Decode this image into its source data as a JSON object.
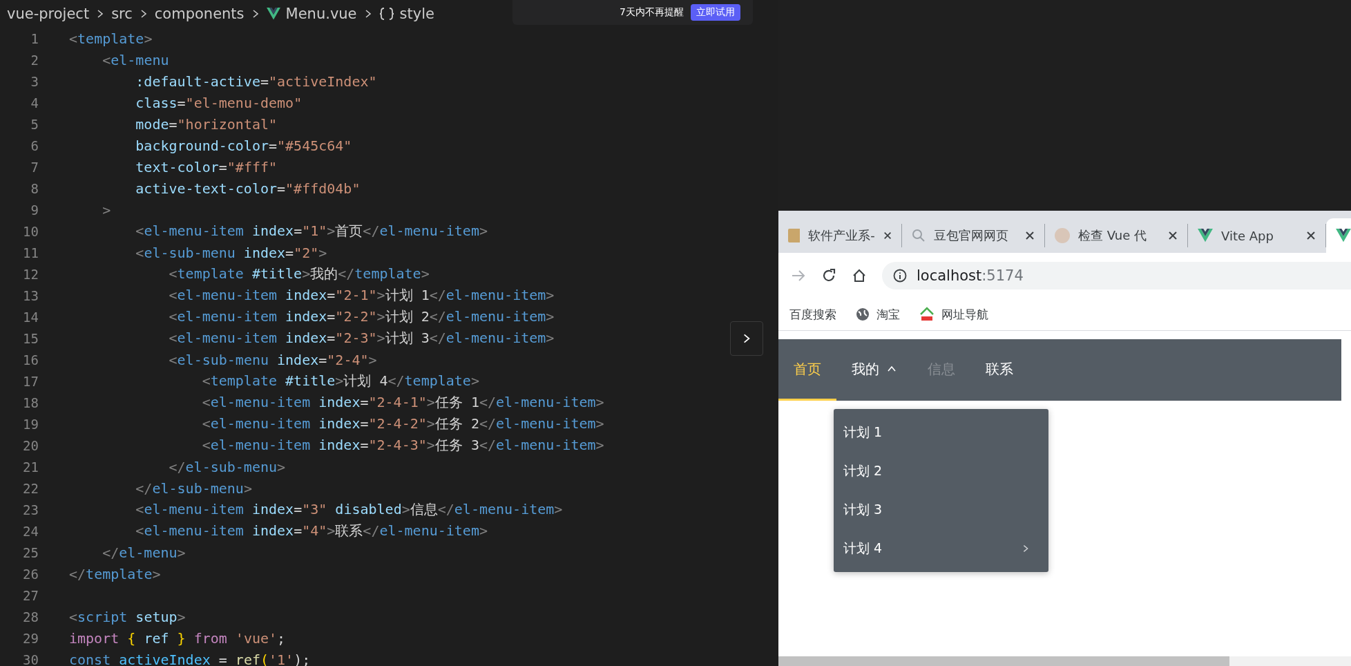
{
  "breadcrumb": [
    {
      "text": "vue-project"
    },
    {
      "text": "src"
    },
    {
      "text": "components"
    },
    {
      "text": "Menu.vue"
    },
    {
      "text": "style"
    }
  ],
  "notification": {
    "text": "7天内不再提醒",
    "button": "立即试用"
  },
  "code_lines": [
    {
      "number": "1",
      "tokens": [
        {
          "kind": "punct",
          "text": "<"
        },
        {
          "kind": "tag",
          "text": "template"
        },
        {
          "kind": "punct",
          "text": ">"
        }
      ]
    },
    {
      "number": "2",
      "tokens": [
        {
          "kind": "punct",
          "text": "    <"
        },
        {
          "kind": "tag",
          "text": "el-menu"
        }
      ]
    },
    {
      "number": "3",
      "tokens": [
        {
          "kind": "attr",
          "text": "        :default-active"
        },
        {
          "kind": "text",
          "text": "="
        },
        {
          "kind": "string",
          "text": "\"activeIndex\""
        }
      ]
    },
    {
      "number": "4",
      "tokens": [
        {
          "kind": "attr",
          "text": "        class"
        },
        {
          "kind": "text",
          "text": "="
        },
        {
          "kind": "string",
          "text": "\"el-menu-demo\""
        }
      ]
    },
    {
      "number": "5",
      "tokens": [
        {
          "kind": "attr",
          "text": "        mode"
        },
        {
          "kind": "text",
          "text": "="
        },
        {
          "kind": "string",
          "text": "\"horizontal\""
        }
      ]
    },
    {
      "number": "6",
      "tokens": [
        {
          "kind": "attr",
          "text": "        background-color"
        },
        {
          "kind": "text",
          "text": "="
        },
        {
          "kind": "string",
          "text": "\"#545c64\""
        }
      ]
    },
    {
      "number": "7",
      "tokens": [
        {
          "kind": "attr",
          "text": "        text-color"
        },
        {
          "kind": "text",
          "text": "="
        },
        {
          "kind": "string",
          "text": "\"#fff\""
        }
      ]
    },
    {
      "number": "8",
      "tokens": [
        {
          "kind": "attr",
          "text": "        active-text-color"
        },
        {
          "kind": "text",
          "text": "="
        },
        {
          "kind": "string",
          "text": "\"#ffd04b\""
        }
      ]
    },
    {
      "number": "9",
      "tokens": [
        {
          "kind": "punct",
          "text": "    >"
        }
      ]
    },
    {
      "number": "10",
      "tokens": [
        {
          "kind": "punct",
          "text": "        <"
        },
        {
          "kind": "tag",
          "text": "el-menu-item"
        },
        {
          "kind": "attr",
          "text": " index"
        },
        {
          "kind": "text",
          "text": "="
        },
        {
          "kind": "string",
          "text": "\"1\""
        },
        {
          "kind": "punct",
          "text": ">"
        },
        {
          "kind": "text",
          "text": "首页"
        },
        {
          "kind": "punct",
          "text": "</"
        },
        {
          "kind": "tag",
          "text": "el-menu-item"
        },
        {
          "kind": "punct",
          "text": ">"
        }
      ]
    },
    {
      "number": "11",
      "tokens": [
        {
          "kind": "punct",
          "text": "        <"
        },
        {
          "kind": "tag",
          "text": "el-sub-menu"
        },
        {
          "kind": "attr",
          "text": " index"
        },
        {
          "kind": "text",
          "text": "="
        },
        {
          "kind": "string",
          "text": "\"2\""
        },
        {
          "kind": "punct",
          "text": ">"
        }
      ]
    },
    {
      "number": "12",
      "tokens": [
        {
          "kind": "punct",
          "text": "            <"
        },
        {
          "kind": "tag",
          "text": "template"
        },
        {
          "kind": "attr",
          "text": " #title"
        },
        {
          "kind": "punct",
          "text": ">"
        },
        {
          "kind": "text",
          "text": "我的"
        },
        {
          "kind": "punct",
          "text": "</"
        },
        {
          "kind": "tag",
          "text": "template"
        },
        {
          "kind": "punct",
          "text": ">"
        }
      ]
    },
    {
      "number": "13",
      "tokens": [
        {
          "kind": "punct",
          "text": "            <"
        },
        {
          "kind": "tag",
          "text": "el-menu-item"
        },
        {
          "kind": "attr",
          "text": " index"
        },
        {
          "kind": "text",
          "text": "="
        },
        {
          "kind": "string",
          "text": "\"2-1\""
        },
        {
          "kind": "punct",
          "text": ">"
        },
        {
          "kind": "text",
          "text": "计划 1"
        },
        {
          "kind": "punct",
          "text": "</"
        },
        {
          "kind": "tag",
          "text": "el-menu-item"
        },
        {
          "kind": "punct",
          "text": ">"
        }
      ]
    },
    {
      "number": "14",
      "tokens": [
        {
          "kind": "punct",
          "text": "            <"
        },
        {
          "kind": "tag",
          "text": "el-menu-item"
        },
        {
          "kind": "attr",
          "text": " index"
        },
        {
          "kind": "text",
          "text": "="
        },
        {
          "kind": "string",
          "text": "\"2-2\""
        },
        {
          "kind": "punct",
          "text": ">"
        },
        {
          "kind": "text",
          "text": "计划 2"
        },
        {
          "kind": "punct",
          "text": "</"
        },
        {
          "kind": "tag",
          "text": "el-menu-item"
        },
        {
          "kind": "punct",
          "text": ">"
        }
      ]
    },
    {
      "number": "15",
      "tokens": [
        {
          "kind": "punct",
          "text": "            <"
        },
        {
          "kind": "tag",
          "text": "el-menu-item"
        },
        {
          "kind": "attr",
          "text": " index"
        },
        {
          "kind": "text",
          "text": "="
        },
        {
          "kind": "string",
          "text": "\"2-3\""
        },
        {
          "kind": "punct",
          "text": ">"
        },
        {
          "kind": "text",
          "text": "计划 3"
        },
        {
          "kind": "punct",
          "text": "</"
        },
        {
          "kind": "tag",
          "text": "el-menu-item"
        },
        {
          "kind": "punct",
          "text": ">"
        }
      ]
    },
    {
      "number": "16",
      "tokens": [
        {
          "kind": "punct",
          "text": "            <"
        },
        {
          "kind": "tag",
          "text": "el-sub-menu"
        },
        {
          "kind": "attr",
          "text": " index"
        },
        {
          "kind": "text",
          "text": "="
        },
        {
          "kind": "string",
          "text": "\"2-4\""
        },
        {
          "kind": "punct",
          "text": ">"
        }
      ]
    },
    {
      "number": "17",
      "tokens": [
        {
          "kind": "punct",
          "text": "                <"
        },
        {
          "kind": "tag",
          "text": "template"
        },
        {
          "kind": "attr",
          "text": " #title"
        },
        {
          "kind": "punct",
          "text": ">"
        },
        {
          "kind": "text",
          "text": "计划 4"
        },
        {
          "kind": "punct",
          "text": "</"
        },
        {
          "kind": "tag",
          "text": "template"
        },
        {
          "kind": "punct",
          "text": ">"
        }
      ]
    },
    {
      "number": "18",
      "tokens": [
        {
          "kind": "punct",
          "text": "                <"
        },
        {
          "kind": "tag",
          "text": "el-menu-item"
        },
        {
          "kind": "attr",
          "text": " index"
        },
        {
          "kind": "text",
          "text": "="
        },
        {
          "kind": "string",
          "text": "\"2-4-1\""
        },
        {
          "kind": "punct",
          "text": ">"
        },
        {
          "kind": "text",
          "text": "任务 1"
        },
        {
          "kind": "punct",
          "text": "</"
        },
        {
          "kind": "tag",
          "text": "el-menu-item"
        },
        {
          "kind": "punct",
          "text": ">"
        }
      ]
    },
    {
      "number": "19",
      "tokens": [
        {
          "kind": "punct",
          "text": "                <"
        },
        {
          "kind": "tag",
          "text": "el-menu-item"
        },
        {
          "kind": "attr",
          "text": " index"
        },
        {
          "kind": "text",
          "text": "="
        },
        {
          "kind": "string",
          "text": "\"2-4-2\""
        },
        {
          "kind": "punct",
          "text": ">"
        },
        {
          "kind": "text",
          "text": "任务 2"
        },
        {
          "kind": "punct",
          "text": "</"
        },
        {
          "kind": "tag",
          "text": "el-menu-item"
        },
        {
          "kind": "punct",
          "text": ">"
        }
      ]
    },
    {
      "number": "20",
      "tokens": [
        {
          "kind": "punct",
          "text": "                <"
        },
        {
          "kind": "tag",
          "text": "el-menu-item"
        },
        {
          "kind": "attr",
          "text": " index"
        },
        {
          "kind": "text",
          "text": "="
        },
        {
          "kind": "string",
          "text": "\"2-4-3\""
        },
        {
          "kind": "punct",
          "text": ">"
        },
        {
          "kind": "text",
          "text": "任务 3"
        },
        {
          "kind": "punct",
          "text": "</"
        },
        {
          "kind": "tag",
          "text": "el-menu-item"
        },
        {
          "kind": "punct",
          "text": ">"
        }
      ]
    },
    {
      "number": "21",
      "tokens": [
        {
          "kind": "punct",
          "text": "            </"
        },
        {
          "kind": "tag",
          "text": "el-sub-menu"
        },
        {
          "kind": "punct",
          "text": ">"
        }
      ]
    },
    {
      "number": "22",
      "tokens": [
        {
          "kind": "punct",
          "text": "        </"
        },
        {
          "kind": "tag",
          "text": "el-sub-menu"
        },
        {
          "kind": "punct",
          "text": ">"
        }
      ]
    },
    {
      "number": "23",
      "tokens": [
        {
          "kind": "punct",
          "text": "        <"
        },
        {
          "kind": "tag",
          "text": "el-menu-item"
        },
        {
          "kind": "attr",
          "text": " index"
        },
        {
          "kind": "text",
          "text": "="
        },
        {
          "kind": "string",
          "text": "\"3\""
        },
        {
          "kind": "attr",
          "text": " disabled"
        },
        {
          "kind": "punct",
          "text": ">"
        },
        {
          "kind": "text",
          "text": "信息"
        },
        {
          "kind": "punct",
          "text": "</"
        },
        {
          "kind": "tag",
          "text": "el-menu-item"
        },
        {
          "kind": "punct",
          "text": ">"
        }
      ]
    },
    {
      "number": "24",
      "tokens": [
        {
          "kind": "punct",
          "text": "        <"
        },
        {
          "kind": "tag",
          "text": "el-menu-item"
        },
        {
          "kind": "attr",
          "text": " index"
        },
        {
          "kind": "text",
          "text": "="
        },
        {
          "kind": "string",
          "text": "\"4\""
        },
        {
          "kind": "punct",
          "text": ">"
        },
        {
          "kind": "text",
          "text": "联系"
        },
        {
          "kind": "punct",
          "text": "</"
        },
        {
          "kind": "tag",
          "text": "el-menu-item"
        },
        {
          "kind": "punct",
          "text": ">"
        }
      ]
    },
    {
      "number": "25",
      "tokens": [
        {
          "kind": "punct",
          "text": "    </"
        },
        {
          "kind": "tag",
          "text": "el-menu"
        },
        {
          "kind": "punct",
          "text": ">"
        }
      ]
    },
    {
      "number": "26",
      "tokens": [
        {
          "kind": "punct",
          "text": "</"
        },
        {
          "kind": "tag",
          "text": "template"
        },
        {
          "kind": "punct",
          "text": ">"
        }
      ]
    },
    {
      "number": "27"
    },
    {
      "number": "28",
      "tokens": [
        {
          "kind": "punct",
          "text": "<"
        },
        {
          "kind": "tag",
          "text": "script"
        },
        {
          "kind": "attr",
          "text": " setup"
        },
        {
          "kind": "punct",
          "text": ">"
        }
      ]
    },
    {
      "number": "29",
      "tokens": [
        {
          "kind": "keyword",
          "text": "import "
        },
        {
          "kind": "brace",
          "text": "{"
        },
        {
          "kind": "variable",
          "text": " ref "
        },
        {
          "kind": "brace",
          "text": "}"
        },
        {
          "kind": "keyword",
          "text": " from "
        },
        {
          "kind": "string",
          "text": "'vue'"
        },
        {
          "kind": "text",
          "text": ";"
        }
      ]
    },
    {
      "number": "30",
      "tokens": [
        {
          "kind": "tag",
          "text": "const"
        },
        {
          "kind": "constant",
          "text": " activeIndex"
        },
        {
          "kind": "text",
          "text": " = "
        },
        {
          "kind": "function",
          "text": "ref"
        },
        {
          "kind": "brace",
          "text": "("
        },
        {
          "kind": "string",
          "text": "'1'"
        },
        {
          "kind": "text",
          "text": ");"
        }
      ]
    }
  ],
  "browser": {
    "tabs": [
      {
        "title": "软件产业系-",
        "selected": false
      },
      {
        "title": "豆包官网网页",
        "selected": false
      },
      {
        "title": "检查 Vue 代",
        "selected": false
      },
      {
        "title": "Vite App",
        "selected": false
      },
      {
        "selected": true
      }
    ],
    "toolbar": {
      "url_host": "localhost",
      "url_port": ":5174"
    },
    "bookmarks": [
      {
        "title": "百度搜索"
      },
      {
        "title": "淘宝"
      },
      {
        "title": "网址导航"
      }
    ],
    "menu": [
      {
        "label": "首页",
        "kind": "item",
        "selected": true,
        "disabled": false
      },
      {
        "label": "我的",
        "kind": "submenu",
        "selected": false,
        "disabled": false,
        "expanded": true
      },
      {
        "label": "信息",
        "kind": "item",
        "selected": false,
        "disabled": true
      },
      {
        "label": "联系",
        "kind": "item",
        "selected": false,
        "disabled": false
      }
    ],
    "submenu": [
      {
        "label": "计划 1",
        "kind": "item"
      },
      {
        "label": "计划 2",
        "kind": "item"
      },
      {
        "label": "计划 3",
        "kind": "item"
      },
      {
        "label": "计划 4",
        "kind": "submenu"
      }
    ]
  }
}
